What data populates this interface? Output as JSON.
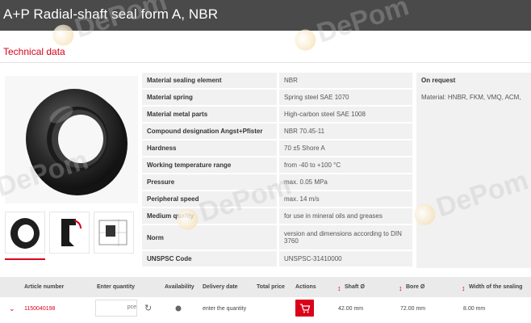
{
  "header": {
    "title": "A+P Radial-shaft seal form A, NBR"
  },
  "section": {
    "title": "Technical data"
  },
  "specs": [
    {
      "label": "Material sealing element",
      "value": "NBR"
    },
    {
      "label": "Material spring",
      "value": "Spring steel SAE 1070"
    },
    {
      "label": "Material metal parts",
      "value": "High-carbon steel SAE 1008"
    },
    {
      "label": "Compound designation Angst+Pfister",
      "value": "NBR 70.45-11"
    },
    {
      "label": "Hardness",
      "value": "70 ±5 Shore A"
    },
    {
      "label": "Working temperature range",
      "value": "from -40 to +100 °C"
    },
    {
      "label": "Pressure",
      "value": "max. 0.05 MPa"
    },
    {
      "label": "Peripheral speed",
      "value": "max. 14 m/s"
    },
    {
      "label": "Medium quality",
      "value": "for use in mineral oils and greases"
    },
    {
      "label": "Norm",
      "value": "version and dimensions according to DIN 3760"
    },
    {
      "label": "UNSPSC Code",
      "value": "UNSPSC-31410000"
    }
  ],
  "on_request": {
    "title": "On request",
    "text": "Material: HNBR, FKM, VMQ, ACM,"
  },
  "order_table": {
    "headers": {
      "article": "Article number",
      "quantity": "Enter quantity",
      "availability": "Availability",
      "delivery": "Delivery date",
      "total": "Total price",
      "actions": "Actions",
      "shaft": "Shaft Ø",
      "bore": "Bore Ø",
      "width": "Width of the sealing"
    },
    "row": {
      "article": "1150040198",
      "quantity_placeholder": "pce",
      "delivery": "enter the quantity",
      "shaft": "42.00 mm",
      "bore": "72.00 mm",
      "width": "8.00 mm"
    }
  },
  "watermark": {
    "text": "DePom"
  },
  "colors": {
    "accent": "#d9001b",
    "header_bg": "#4a4a4a",
    "row_bg": "#f1f1f1"
  },
  "icons": [
    "chevron-down-icon",
    "refresh-icon",
    "availability-dot-icon",
    "cart-icon",
    "sort-arrows-icon"
  ]
}
